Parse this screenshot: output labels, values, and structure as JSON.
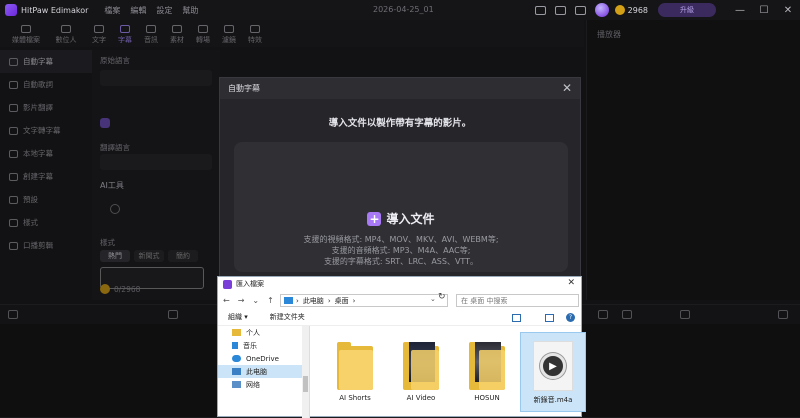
{
  "titlebar": {
    "app_name": "HitPaw Edimakor",
    "menu": [
      "檔案",
      "編輯",
      "設定",
      "幫助"
    ],
    "date": "2026-04-25_01",
    "credits": "2968",
    "upgrade_label": "升級",
    "minimize": "—",
    "maximize": "☐",
    "close": "✕"
  },
  "toolbar": {
    "tools": [
      {
        "label": "媒體檔案",
        "icon": "media-icon"
      },
      {
        "label": "數位人",
        "icon": "avatar-icon"
      },
      {
        "label": "文字",
        "icon": "text-icon"
      },
      {
        "label": "字幕",
        "icon": "subtitle-icon"
      },
      {
        "label": "音訊",
        "icon": "audio-icon"
      },
      {
        "label": "素材",
        "icon": "assets-icon"
      },
      {
        "label": "轉場",
        "icon": "transition-icon"
      },
      {
        "label": "濾鏡",
        "icon": "filter-icon"
      },
      {
        "label": "特效",
        "icon": "effects-icon"
      }
    ],
    "active_index": 3
  },
  "preview": {
    "title": "播放器"
  },
  "sidebar": {
    "items": [
      {
        "label": "自動字幕",
        "icon": "auto-subtitle-icon"
      },
      {
        "label": "自動歌詞",
        "icon": "lyrics-icon"
      },
      {
        "label": "影片翻譯",
        "icon": "translate-icon"
      },
      {
        "label": "文字轉字幕",
        "icon": "text-to-subtitle-icon"
      },
      {
        "label": "本地字幕",
        "icon": "local-subtitle-icon"
      },
      {
        "label": "創建字幕",
        "icon": "create-subtitle-icon"
      },
      {
        "label": "預設",
        "icon": "preset-icon"
      },
      {
        "label": "樣式",
        "icon": "style-icon"
      },
      {
        "label": "口播剪輯",
        "icon": "voice-edit-icon"
      }
    ],
    "active_index": 0
  },
  "settings": {
    "original_lang_label": "原始語言",
    "translate_label": "翻譯語言",
    "ai_tools_label": "AI工具",
    "style_label": "樣式",
    "style_chips": [
      "熱門",
      "新聞式",
      "簡約",
      "標題"
    ],
    "credits": "0/2968"
  },
  "modal": {
    "title": "自動字幕",
    "close": "✕",
    "description": "導入文件以製作帶有字幕的影片。",
    "import_label": "導入文件",
    "plus": "+",
    "formats": [
      "支援的視頻格式: MP4、MOV、MKV、AVI、WEBM等;",
      "支援的音頻格式: MP3、M4A、AAC等;",
      "支援的字幕格式: SRT、LRC、ASS、VTT。"
    ]
  },
  "file_dialog": {
    "title": "匯入檔案",
    "close": "✕",
    "back": "←",
    "forward": "→",
    "dropdown": "⌄",
    "up": "↑",
    "path": [
      "此电脑",
      "桌面"
    ],
    "path_sep": "›",
    "refresh": "↻",
    "search_placeholder": "在 桌面 中搜索",
    "organize": "組織 ▾",
    "new_folder": "新建文件夹",
    "help": "?",
    "tree": [
      {
        "label": "个人",
        "icon": "folder-icon"
      },
      {
        "label": "音乐",
        "icon": "music-icon"
      },
      {
        "label": "OneDrive",
        "icon": "cloud-icon"
      },
      {
        "label": "此电脑",
        "icon": "computer-icon"
      },
      {
        "label": "网络",
        "icon": "network-icon"
      }
    ],
    "tree_selected": 3,
    "files": [
      {
        "name": "AI Shorts",
        "type": "folder"
      },
      {
        "name": "AI Video",
        "type": "folder-image"
      },
      {
        "name": "HOSUN",
        "type": "folder-image"
      },
      {
        "name": "新錄音.m4a",
        "type": "audio"
      }
    ],
    "files_selected": 3
  },
  "colors": {
    "accent": "#a779f5",
    "folder": "#f7d26b",
    "selection": "#cce4f7"
  }
}
